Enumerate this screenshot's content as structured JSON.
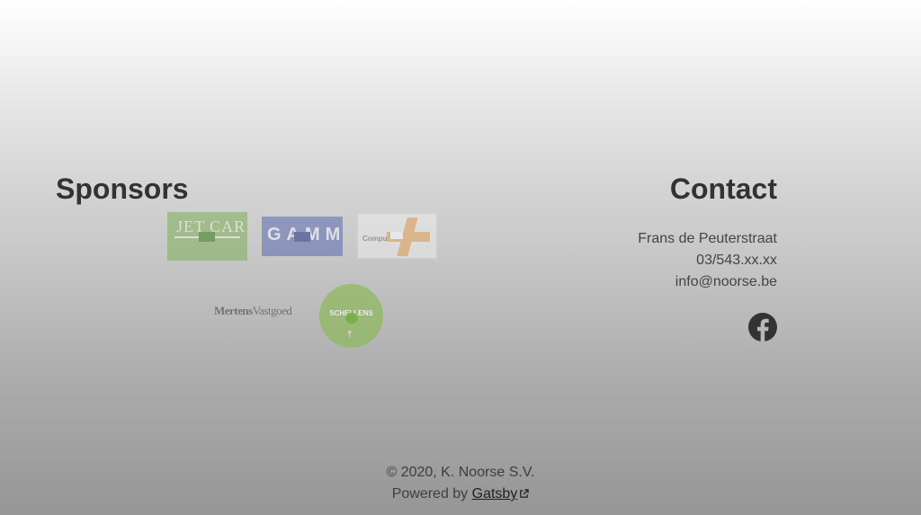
{
  "sponsors": {
    "title": "Sponsors",
    "logos": [
      {
        "name": "JET CAR",
        "text": "JET CAR",
        "color": "#7fae5a"
      },
      {
        "name": "GAMMA",
        "text": "GAMMA",
        "color": "#5a6bb0"
      },
      {
        "name": "CompuBank",
        "text": "Compu",
        "color": "#e8a45a"
      },
      {
        "name": "Mertens Vastgoed",
        "text_bold": "Mertens",
        "text_light": "Vastgoed"
      },
      {
        "name": "Schellens",
        "text": "SCHELLENS",
        "color": "#8db85a"
      }
    ]
  },
  "contact": {
    "title": "Contact",
    "address": "Frans de Peuterstraat",
    "phone": "03/543.xx.xx",
    "email": "info@noorse.be",
    "social_icon": "facebook-icon"
  },
  "footer": {
    "copyright": "© 2020, K. Noorse S.V.",
    "powered_prefix": "Powered by ",
    "powered_link": "Gatsby",
    "link_icon": "external-link-icon"
  }
}
